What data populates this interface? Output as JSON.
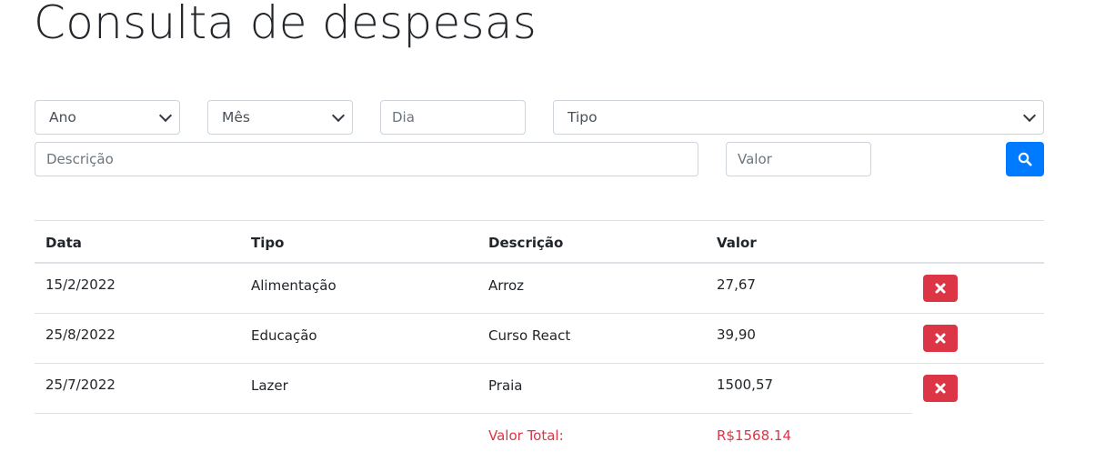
{
  "page": {
    "title": "Consulta de despesas"
  },
  "filters": {
    "ano": "Ano",
    "mes": "Mês",
    "dia_placeholder": "Dia",
    "tipo": "Tipo",
    "descricao_placeholder": "Descrição",
    "valor_placeholder": "Valor",
    "search_icon": "search-icon"
  },
  "table": {
    "headers": [
      "Data",
      "Tipo",
      "Descrição",
      "Valor"
    ],
    "rows": [
      {
        "data": "15/2/2022",
        "tipo": "Alimentação",
        "descricao": "Arroz",
        "valor": "27,67"
      },
      {
        "data": "25/8/2022",
        "tipo": "Educação",
        "descricao": "Curso React",
        "valor": "39,90"
      },
      {
        "data": "25/7/2022",
        "tipo": "Lazer",
        "descricao": "Praia",
        "valor": "1500,57"
      }
    ],
    "delete_icon": "close-icon",
    "total_label": "Valor Total:",
    "total_value": "R$1568.14"
  },
  "colors": {
    "primary": "#007bff",
    "danger": "#dc3545",
    "border": "#ced4da"
  }
}
